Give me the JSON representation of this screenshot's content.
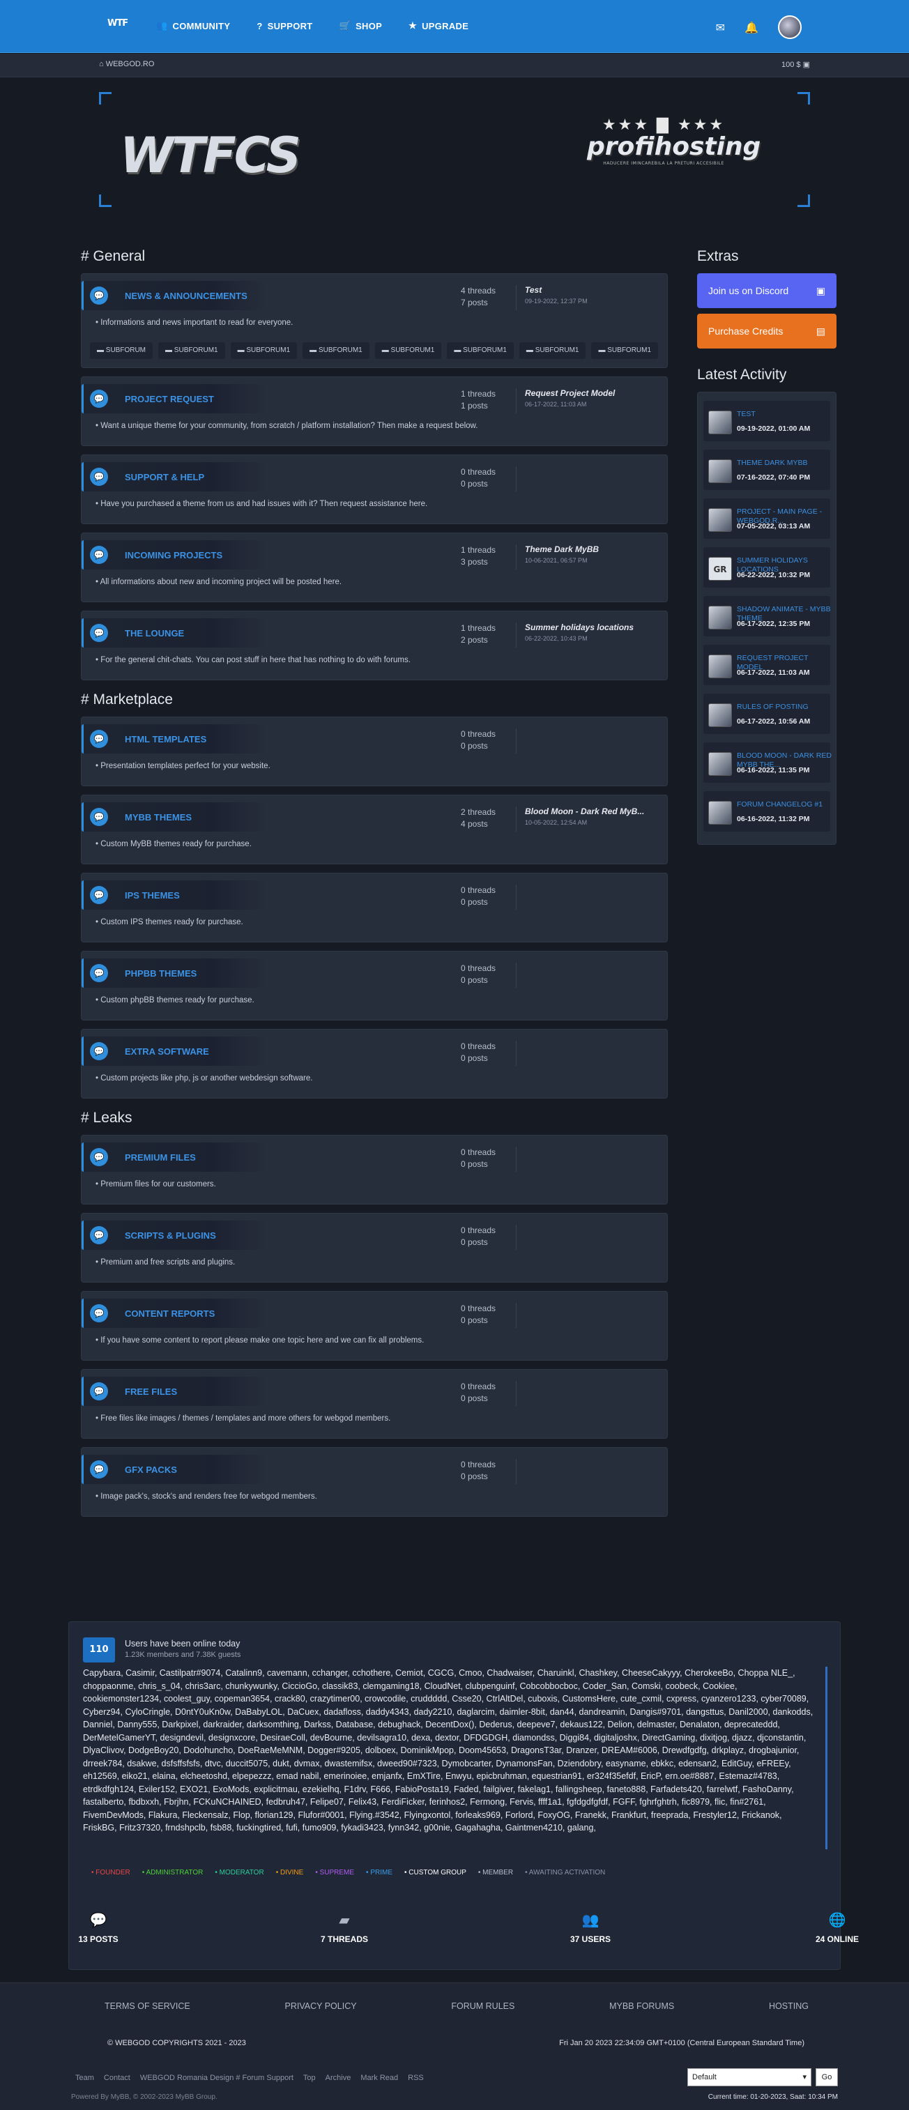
{
  "nav": {
    "logo": "WTF",
    "items": [
      {
        "icon": "👥",
        "label": "COMMUNITY"
      },
      {
        "icon": "?",
        "label": "SUPPORT"
      },
      {
        "icon": "🛒",
        "label": "SHOP"
      },
      {
        "icon": "★",
        "label": "UPGRADE"
      }
    ]
  },
  "subbar": {
    "crumb": "WEBGOD.RO",
    "credits": "100 $"
  },
  "banner": {
    "left_logo": "WTFCS",
    "right_name": "profihosting",
    "right_tag": "HADUCERE IMINCAREBILA LA PRETURI ACCESIBILE"
  },
  "categories": [
    {
      "title": "# General",
      "forums": [
        {
          "name": "NEWS & ANNOUNCEMENTS",
          "threads": "4 threads",
          "posts": "7 posts",
          "last_title": "Test",
          "last_date": "09-19-2022, 12:37 PM",
          "desc": "• Informations and news important to read for everyone.",
          "subforums": [
            "SUBFORUM",
            "SUBFORUM1",
            "SUBFORUM1",
            "SUBFORUM1",
            "SUBFORUM1",
            "SUBFORUM1",
            "SUBFORUM1",
            "SUBFORUM1"
          ]
        },
        {
          "name": "PROJECT REQUEST",
          "threads": "1 threads",
          "posts": "1 posts",
          "last_title": "Request Project Model",
          "last_date": "06-17-2022, 11:03 AM",
          "desc": "• Want a unique theme for your community, from scratch / platform installation? Then make a request below."
        },
        {
          "name": "SUPPORT & HELP",
          "threads": "0 threads",
          "posts": "0 posts",
          "last_title": "",
          "last_date": "",
          "desc": "• Have you purchased a theme from us and had issues with it? Then request assistance here."
        },
        {
          "name": "INCOMING PROJECTS",
          "threads": "1 threads",
          "posts": "3 posts",
          "last_title": "Theme Dark MyBB",
          "last_date": "10-06-2021, 06:57 PM",
          "desc": "• All informations about new and incoming project will be posted here."
        },
        {
          "name": "THE LOUNGE",
          "threads": "1 threads",
          "posts": "2 posts",
          "last_title": "Summer holidays locations",
          "last_date": "06-22-2022, 10:43 PM",
          "desc": "• For the general chit-chats. You can post stuff in here that has nothing to do with forums."
        }
      ]
    },
    {
      "title": "# Marketplace",
      "forums": [
        {
          "name": "HTML TEMPLATES",
          "threads": "0 threads",
          "posts": "0 posts",
          "last_title": "",
          "last_date": "",
          "desc": "• Presentation templates perfect for your website."
        },
        {
          "name": "MYBB THEMES",
          "threads": "2 threads",
          "posts": "4 posts",
          "last_title": "Blood Moon - Dark Red MyB...",
          "last_date": "10-05-2022, 12:54 AM",
          "desc": "• Custom MyBB themes ready for purchase."
        },
        {
          "name": "IPS THEMES",
          "threads": "0 threads",
          "posts": "0 posts",
          "last_title": "",
          "last_date": "",
          "desc": "• Custom IPS themes ready for purchase."
        },
        {
          "name": "PHPBB THEMES",
          "threads": "0 threads",
          "posts": "0 posts",
          "last_title": "",
          "last_date": "",
          "desc": "• Custom phpBB themes ready for purchase."
        },
        {
          "name": "EXTRA SOFTWARE",
          "threads": "0 threads",
          "posts": "0 posts",
          "last_title": "",
          "last_date": "",
          "desc": "• Custom projects like php, js or another webdesign software."
        }
      ]
    },
    {
      "title": "# Leaks",
      "forums": [
        {
          "name": "PREMIUM FILES",
          "threads": "0 threads",
          "posts": "0 posts",
          "last_title": "",
          "last_date": "",
          "desc": "• Premium files for our customers."
        },
        {
          "name": "SCRIPTS & PLUGINS",
          "threads": "0 threads",
          "posts": "0 posts",
          "last_title": "",
          "last_date": "",
          "desc": "• Premium and free scripts and plugins."
        },
        {
          "name": "CONTENT REPORTS",
          "threads": "0 threads",
          "posts": "0 posts",
          "last_title": "",
          "last_date": "",
          "desc": "• If you have some content to report please make one topic here and we can fix all problems."
        },
        {
          "name": "FREE FILES",
          "threads": "0 threads",
          "posts": "0 posts",
          "last_title": "",
          "last_date": "",
          "desc": "• Free files like images / themes / templates and more others for webgod members."
        },
        {
          "name": "GFX PACKS",
          "threads": "0 threads",
          "posts": "0 posts",
          "last_title": "",
          "last_date": "",
          "desc": "• Image pack's, stock's and renders free for webgod members."
        }
      ]
    }
  ],
  "sidebar": {
    "extras_title": "Extras",
    "discord": "Join us on Discord",
    "credits": "Purchase Credits",
    "activity_title": "Latest Activity",
    "activity": [
      {
        "title": "TEST",
        "date": "09-19-2022, 01:00 AM",
        "avatar": ""
      },
      {
        "title": "THEME DARK MYBB",
        "date": "07-16-2022, 07:40 PM",
        "avatar": ""
      },
      {
        "title": "PROJECT - MAIN PAGE - WEBGOD.R...",
        "date": "07-05-2022, 03:13 AM",
        "avatar": ""
      },
      {
        "title": "SUMMER HOLIDAYS LOCATIONS",
        "date": "06-22-2022, 10:32 PM",
        "avatar": "GR"
      },
      {
        "title": "SHADOW ANIMATE - MYBB THEME",
        "date": "06-17-2022, 12:35 PM",
        "avatar": ""
      },
      {
        "title": "REQUEST PROJECT MODEL",
        "date": "06-17-2022, 11:03 AM",
        "avatar": ""
      },
      {
        "title": "RULES OF POSTING",
        "date": "06-17-2022, 10:56 AM",
        "avatar": ""
      },
      {
        "title": "BLOOD MOON - DARK RED MYBB THE...",
        "date": "06-16-2022, 11:35 PM",
        "avatar": ""
      },
      {
        "title": "FORUM CHANGELOG #1",
        "date": "06-16-2022, 11:32 PM",
        "avatar": ""
      }
    ]
  },
  "online": {
    "count": "110",
    "title": "Users have been online today",
    "sub": "1.23K members and 7.38K guests",
    "users": "Capybara, Casimir, Castilpatr#9074, Catalinn9, cavemann, cchanger, cchothere, Cemiot, CGCG, Cmoo, Chadwaiser, Charuinkl, Chashkey, CheeseCakyyy, CherokeeBo, Choppa NLE_, choppaonme, chris_s_04, chris3arc, chunkywunky, CiccioGo, classik83, clemgaming18, CloudNet, clubpenguinf, Cobcobbocboc, Coder_San, Comski, coobeck, Cookiee, cookiemonster1234, coolest_guy, copeman3654, crack80, crazytimer00, crowcodile, cruddddd, Csse20, CtrlAltDel, cuboxis, CustomsHere, cute_cxmil, cxpress, cyanzero1233, cyber70089, Cyberz94, CyloCringle, D0ntY0uKn0w, DaBabyLOL, DaCuex, dadafloss, daddy4343, dady2210, daglarcim, daimler-8bit, dan44, dandreamin, Dangis#9701, dangsttus, Danil2000, dankodds, Danniel, Danny555, Darkpixel, darkraider, darksomthing, Darkss, Database, debughack, DecentDox(), Dederus, deepeve7, dekaus122, Delion, delmaster, Denalaton, deprecateddd, DerMetelGamerYT, designdevil, designxcore, DesiraeColl, devBourne, devilsagra10, dexa, dextor, DFDGDGH, diamondss, Diggi84, digitaljoshx, DirectGaming, dixitjog, djazz, djconstantin, DlyaClivov, DodgeBoy20, Dodohuncho, DoeRaeMeMNM, Dogger#9205, dolboex, DominikMpop, Doom45653, DragonsT3ar, Dranzer, DREAM#6006, Drewdfgdfg, drkplayz, drogbajunior, drreek784, dsakwe, dsfsffsfsfs, dtvc, duccit5075, dukt, dvmax, dwastemifsx, dweed90#7323, Dymobcarter, DynamonsFan, Dziendobry, easyname, ebkkc, edensan2, EditGuy, eFREEy, eh12569, eiko21, elaina, elcheetoshd, elpepezzz, emad nabil, emerinoiee, emjanfx, EmXTire, Enwyu, epicbruhman, equestrian91, er324f35efdf, EricP, ern.oe#8887, Estemaz#4783, etrdkdfgh124, Exiler152, EXO21, ExoMods, explicitmau, ezekielhq, F1drv, F666, FabioPosta19, Faded, failgiver, fakelag1, fallingsheep, faneto888, Farfadets420, farrelwtf, FashoDanny, fastalberto, fbdbxxh, Fbrjhn, FCKuNCHAINED, fedbruh47, Felipe07, Felix43, FerdiFicker, ferinhos2, Fermong, Fervis, ffff1a1, fgfdgdfgfdf, FGFF, fghrfghtrh, fic8979, flic, fin#2761, FivemDevMods, Flakura, Fleckensalz, Flop, florian129, Flufor#0001, Flying.#3542, Flyingxontol, forleaks969, Forlord, FoxyOG, Franekk, Frankfurt, freeprada, Frestyler12, Frickanok, FriskBG, Fritz37320, frndshpclb, fsb88, fuckingtired, fufi, fumo909, fykadi3423, fynn342, g00nie, Gagahagha, Gaintmen4210, galang,"
  },
  "legend": [
    {
      "label": "• FOUNDER",
      "color": "#e84545"
    },
    {
      "label": "• ADMINISTRATOR",
      "color": "#4cd137"
    },
    {
      "label": "• MODERATOR",
      "color": "#2ecc9a"
    },
    {
      "label": "• DIVINE",
      "color": "#f39c12"
    },
    {
      "label": "• SUPREME",
      "color": "#b25cf2"
    },
    {
      "label": "• PRIME",
      "color": "#3c9ee8"
    },
    {
      "label": "• CUSTOM GROUP",
      "color": "#ffffff"
    },
    {
      "label": "• MEMBER",
      "color": "#b7bfcc"
    },
    {
      "label": "• AWAITING ACTIVATION",
      "color": "#8a94a6"
    }
  ],
  "stats": [
    {
      "icon": "💬",
      "value": "13 POSTS"
    },
    {
      "icon": "▰",
      "value": "7 THREADS"
    },
    {
      "icon": "👥",
      "value": "37 USERS"
    },
    {
      "icon": "🌐",
      "value": "24 ONLINE"
    }
  ],
  "footer": {
    "links": [
      "TERMS OF SERVICE",
      "PRIVACY POLICY",
      "FORUM RULES",
      "MYBB FORUMS",
      "HOSTING"
    ],
    "copyright": "© WEBGOD COPYRIGHTS 2021 - 2023",
    "clock": "Fri Jan 20 2023 22:34:09 GMT+0100 (Central European Standard Time)",
    "bottom_links": [
      "Team",
      "Contact",
      "WEBGOD Romania Design # Forum Support",
      "Top",
      "Archive",
      "Mark Read",
      "RSS"
    ],
    "powered": "Powered By MyBB, © 2002-2023 MyBB Group.",
    "current_time": "Current time: 01-20-2023, Saat: 10:34 PM",
    "theme_select": "Default",
    "go": "Go"
  }
}
